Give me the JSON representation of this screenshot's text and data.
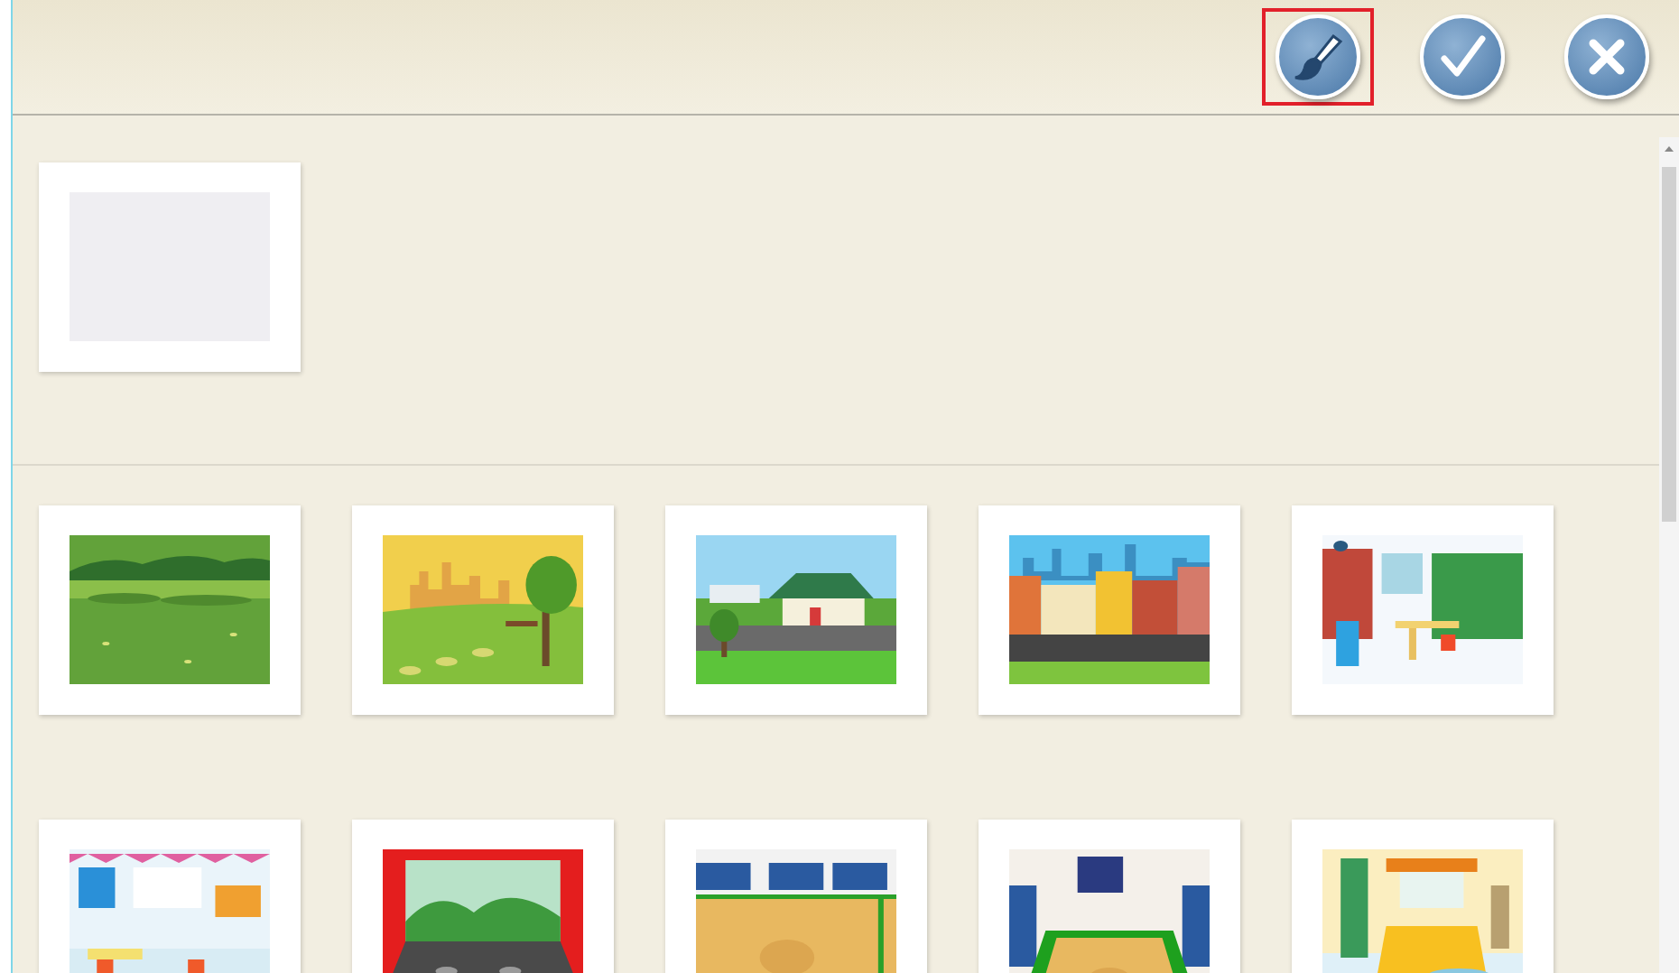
{
  "toolbar": {
    "buttons": [
      {
        "kind": "paint",
        "selected": true
      },
      {
        "kind": "confirm",
        "selected": false
      },
      {
        "kind": "close",
        "selected": false
      }
    ]
  },
  "blank_backgrounds": [
    {
      "kind": "blank"
    }
  ],
  "scenes": [
    {
      "kind": "meadow"
    },
    {
      "kind": "park"
    },
    {
      "kind": "suburb"
    },
    {
      "kind": "city"
    },
    {
      "kind": "library"
    },
    {
      "kind": "classroom"
    },
    {
      "kind": "stage"
    },
    {
      "kind": "gym"
    },
    {
      "kind": "court"
    },
    {
      "kind": "bedroom"
    }
  ]
}
